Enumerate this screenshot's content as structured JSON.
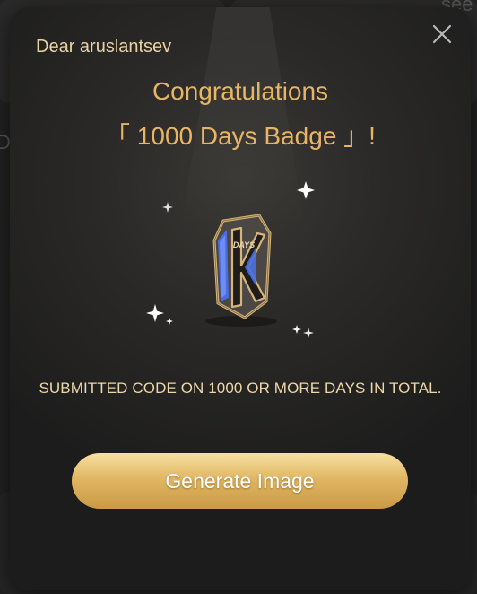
{
  "modal": {
    "greeting": "Dear aruslantsev",
    "title_line1": "Congratulations",
    "title_line2": "「 1000 Days Badge 」!",
    "badge": {
      "label": "DAYS",
      "letter": "K"
    },
    "description": "SUBMITTED CODE ON 1000 OR MORE DAYS IN TOTAL.",
    "generate_button_label": "Generate Image",
    "close_icon": "close-icon"
  },
  "background": {
    "partial_text_top_right": "see",
    "partial_text_left": "D."
  },
  "colors": {
    "gold_text": "#e8b564",
    "cream_text": "#eed7a8",
    "button_gold": "#e1b763",
    "badge_blue": "#4a6ee0"
  }
}
